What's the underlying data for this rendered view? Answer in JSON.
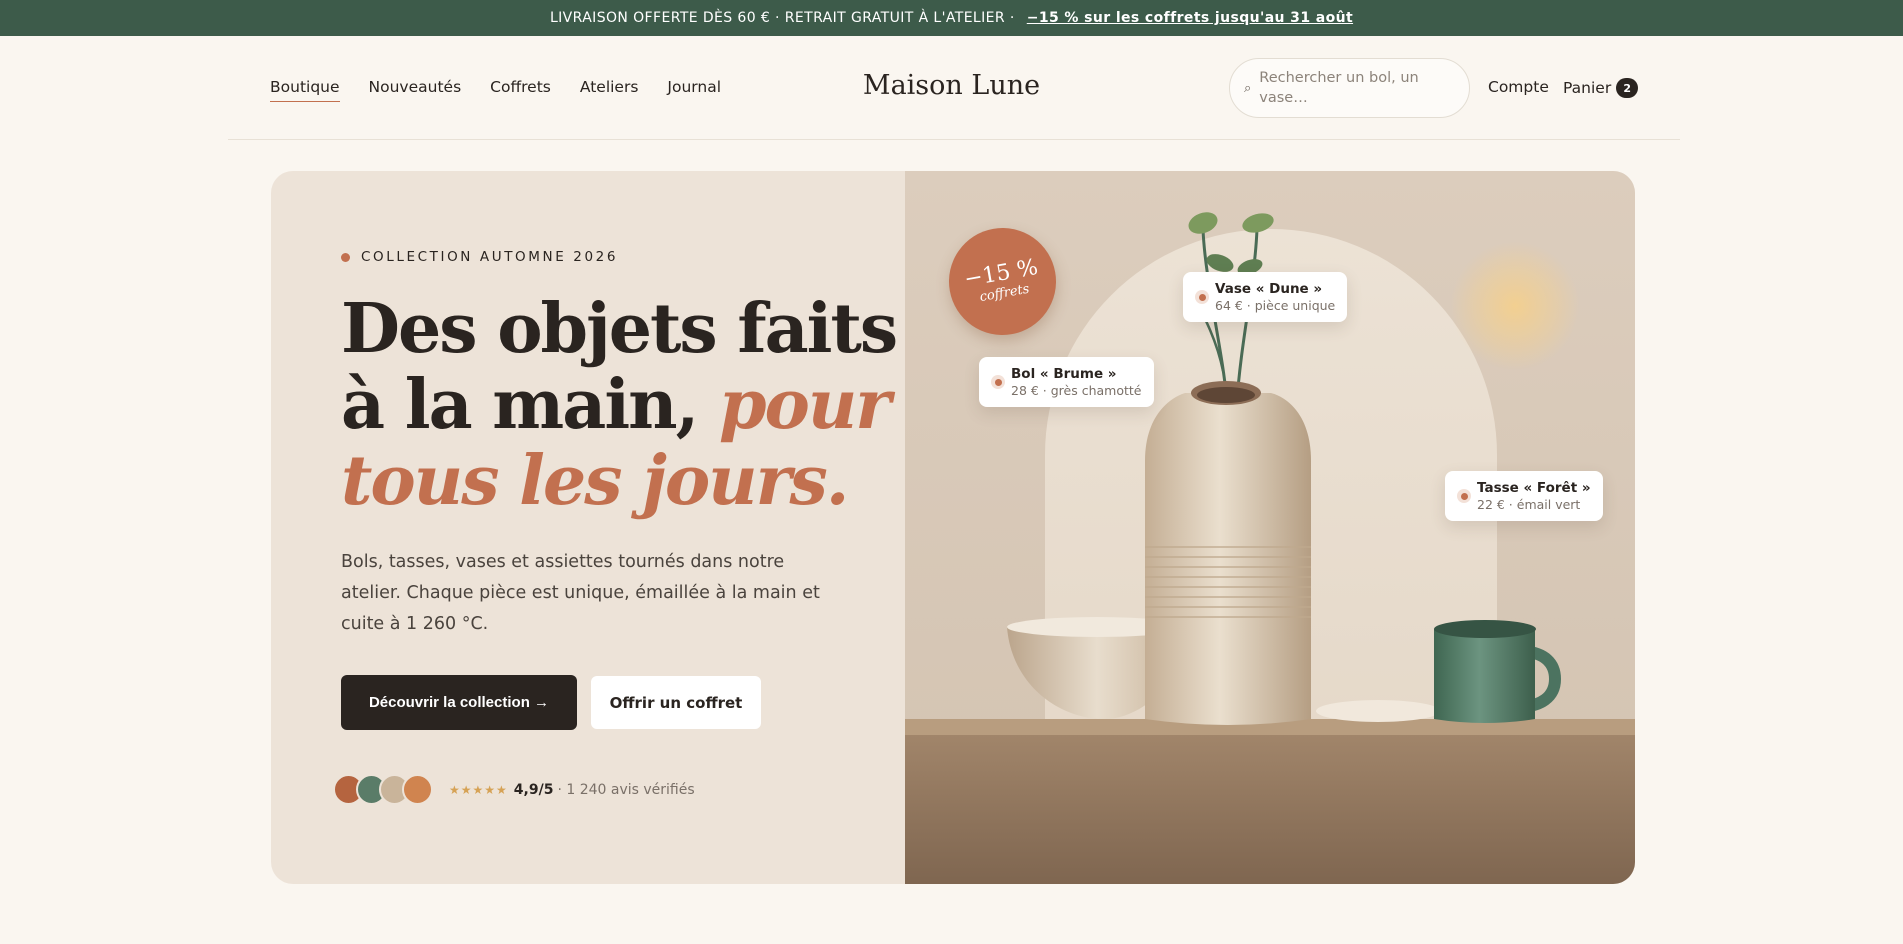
{
  "announcement": {
    "text": "LIVRAISON OFFERTE DÈS 60 € · RETRAIT GRATUIT À L'ATELIER ·",
    "promo": "−15 % sur les coffrets jusqu'au 31 août"
  },
  "nav": {
    "links": [
      "Boutique",
      "Nouveautés",
      "Coffrets",
      "Ateliers",
      "Journal"
    ],
    "logo": "Maison Lune",
    "search_placeholder": "Rechercher un bol, un vase…",
    "account": "Compte",
    "cart": "Panier",
    "cart_count": "2"
  },
  "hero": {
    "eyebrow": "COLLECTION AUTOMNE 2026",
    "headline_line1": "Des objets faits",
    "headline_line2": "à la main,",
    "headline_em1": "pour",
    "headline_em2": "tous les jours.",
    "description": "Bols, tasses, vases et assiettes tournés dans notre atelier. Chaque pièce est unique, émaillée à la main et cuite à 1 260 °C.",
    "cta_primary": "Découvrir la collection →",
    "cta_secondary": "Offrir un coffret",
    "stars": "★★★★★",
    "rating": "4,9/5",
    "reviews": "· 1 240 avis vérifiés",
    "avatar_colors": [
      "#b5643f",
      "#5a7c68",
      "#c9b49a",
      "#d0844f"
    ]
  },
  "visual": {
    "discount_value": "−15 %",
    "discount_label": "coffrets",
    "tags": [
      {
        "name": "Vase « Dune »",
        "info": "64 € · pièce unique"
      },
      {
        "name": "Bol « Brume »",
        "info": "28 € · grès chamotté"
      },
      {
        "name": "Tasse « Forêt »",
        "info": "22 € · émail vert"
      }
    ]
  },
  "colors": {
    "accent": "#c2704f",
    "green": "#3d5b4a",
    "dark": "#2a2420",
    "cream": "#faf6f0"
  }
}
